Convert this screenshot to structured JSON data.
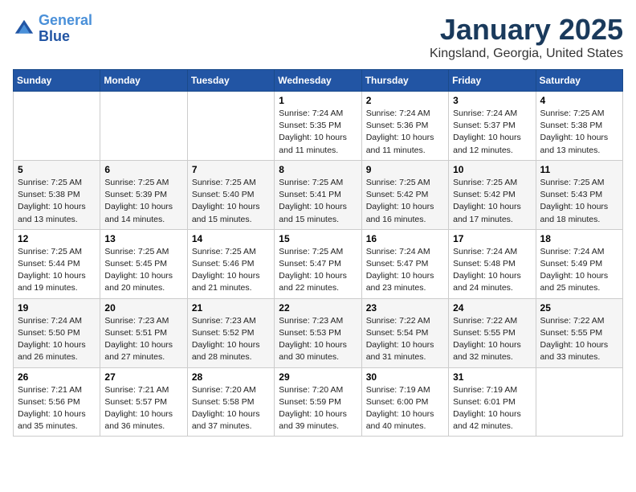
{
  "header": {
    "logo_line1": "General",
    "logo_line2": "Blue",
    "title": "January 2025",
    "subtitle": "Kingsland, Georgia, United States"
  },
  "weekdays": [
    "Sunday",
    "Monday",
    "Tuesday",
    "Wednesday",
    "Thursday",
    "Friday",
    "Saturday"
  ],
  "weeks": [
    [
      {
        "day": "",
        "info": ""
      },
      {
        "day": "",
        "info": ""
      },
      {
        "day": "",
        "info": ""
      },
      {
        "day": "1",
        "info": "Sunrise: 7:24 AM\nSunset: 5:35 PM\nDaylight: 10 hours\nand 11 minutes."
      },
      {
        "day": "2",
        "info": "Sunrise: 7:24 AM\nSunset: 5:36 PM\nDaylight: 10 hours\nand 11 minutes."
      },
      {
        "day": "3",
        "info": "Sunrise: 7:24 AM\nSunset: 5:37 PM\nDaylight: 10 hours\nand 12 minutes."
      },
      {
        "day": "4",
        "info": "Sunrise: 7:25 AM\nSunset: 5:38 PM\nDaylight: 10 hours\nand 13 minutes."
      }
    ],
    [
      {
        "day": "5",
        "info": "Sunrise: 7:25 AM\nSunset: 5:38 PM\nDaylight: 10 hours\nand 13 minutes."
      },
      {
        "day": "6",
        "info": "Sunrise: 7:25 AM\nSunset: 5:39 PM\nDaylight: 10 hours\nand 14 minutes."
      },
      {
        "day": "7",
        "info": "Sunrise: 7:25 AM\nSunset: 5:40 PM\nDaylight: 10 hours\nand 15 minutes."
      },
      {
        "day": "8",
        "info": "Sunrise: 7:25 AM\nSunset: 5:41 PM\nDaylight: 10 hours\nand 15 minutes."
      },
      {
        "day": "9",
        "info": "Sunrise: 7:25 AM\nSunset: 5:42 PM\nDaylight: 10 hours\nand 16 minutes."
      },
      {
        "day": "10",
        "info": "Sunrise: 7:25 AM\nSunset: 5:42 PM\nDaylight: 10 hours\nand 17 minutes."
      },
      {
        "day": "11",
        "info": "Sunrise: 7:25 AM\nSunset: 5:43 PM\nDaylight: 10 hours\nand 18 minutes."
      }
    ],
    [
      {
        "day": "12",
        "info": "Sunrise: 7:25 AM\nSunset: 5:44 PM\nDaylight: 10 hours\nand 19 minutes."
      },
      {
        "day": "13",
        "info": "Sunrise: 7:25 AM\nSunset: 5:45 PM\nDaylight: 10 hours\nand 20 minutes."
      },
      {
        "day": "14",
        "info": "Sunrise: 7:25 AM\nSunset: 5:46 PM\nDaylight: 10 hours\nand 21 minutes."
      },
      {
        "day": "15",
        "info": "Sunrise: 7:25 AM\nSunset: 5:47 PM\nDaylight: 10 hours\nand 22 minutes."
      },
      {
        "day": "16",
        "info": "Sunrise: 7:24 AM\nSunset: 5:47 PM\nDaylight: 10 hours\nand 23 minutes."
      },
      {
        "day": "17",
        "info": "Sunrise: 7:24 AM\nSunset: 5:48 PM\nDaylight: 10 hours\nand 24 minutes."
      },
      {
        "day": "18",
        "info": "Sunrise: 7:24 AM\nSunset: 5:49 PM\nDaylight: 10 hours\nand 25 minutes."
      }
    ],
    [
      {
        "day": "19",
        "info": "Sunrise: 7:24 AM\nSunset: 5:50 PM\nDaylight: 10 hours\nand 26 minutes."
      },
      {
        "day": "20",
        "info": "Sunrise: 7:23 AM\nSunset: 5:51 PM\nDaylight: 10 hours\nand 27 minutes."
      },
      {
        "day": "21",
        "info": "Sunrise: 7:23 AM\nSunset: 5:52 PM\nDaylight: 10 hours\nand 28 minutes."
      },
      {
        "day": "22",
        "info": "Sunrise: 7:23 AM\nSunset: 5:53 PM\nDaylight: 10 hours\nand 30 minutes."
      },
      {
        "day": "23",
        "info": "Sunrise: 7:22 AM\nSunset: 5:54 PM\nDaylight: 10 hours\nand 31 minutes."
      },
      {
        "day": "24",
        "info": "Sunrise: 7:22 AM\nSunset: 5:55 PM\nDaylight: 10 hours\nand 32 minutes."
      },
      {
        "day": "25",
        "info": "Sunrise: 7:22 AM\nSunset: 5:55 PM\nDaylight: 10 hours\nand 33 minutes."
      }
    ],
    [
      {
        "day": "26",
        "info": "Sunrise: 7:21 AM\nSunset: 5:56 PM\nDaylight: 10 hours\nand 35 minutes."
      },
      {
        "day": "27",
        "info": "Sunrise: 7:21 AM\nSunset: 5:57 PM\nDaylight: 10 hours\nand 36 minutes."
      },
      {
        "day": "28",
        "info": "Sunrise: 7:20 AM\nSunset: 5:58 PM\nDaylight: 10 hours\nand 37 minutes."
      },
      {
        "day": "29",
        "info": "Sunrise: 7:20 AM\nSunset: 5:59 PM\nDaylight: 10 hours\nand 39 minutes."
      },
      {
        "day": "30",
        "info": "Sunrise: 7:19 AM\nSunset: 6:00 PM\nDaylight: 10 hours\nand 40 minutes."
      },
      {
        "day": "31",
        "info": "Sunrise: 7:19 AM\nSunset: 6:01 PM\nDaylight: 10 hours\nand 42 minutes."
      },
      {
        "day": "",
        "info": ""
      }
    ]
  ]
}
